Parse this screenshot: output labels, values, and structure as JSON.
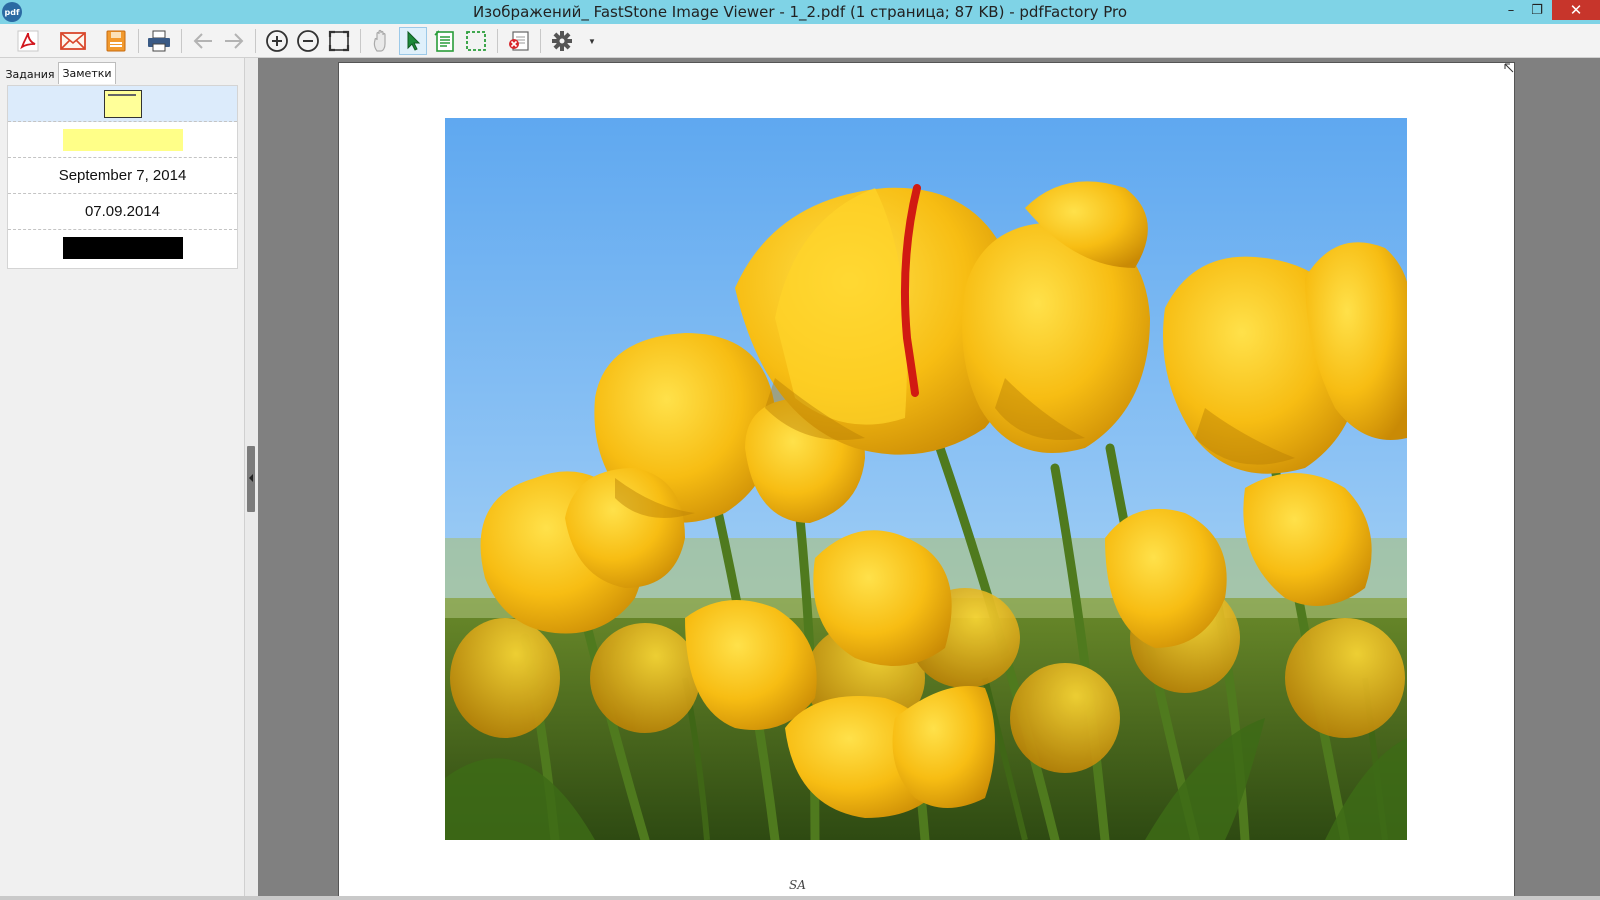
{
  "window": {
    "app_icon": "pdf",
    "title": "Изображений_ FastStone Image Viewer - 1_2.pdf (1 страница; 87 KB) - pdfFactory Pro",
    "controls": {
      "minimize": "–",
      "maximize": "❐",
      "close": "✕"
    }
  },
  "toolbar": {
    "buttons": [
      {
        "icon": "pdf-acrobat-icon"
      },
      {
        "icon": "email-icon"
      },
      {
        "icon": "save-icon"
      },
      {
        "icon": "print-icon"
      },
      {
        "icon": "back-arrow-icon"
      },
      {
        "icon": "forward-arrow-icon"
      },
      {
        "icon": "zoom-in-icon"
      },
      {
        "icon": "zoom-out-icon"
      },
      {
        "icon": "fit-page-icon"
      },
      {
        "icon": "hand-pan-icon"
      },
      {
        "icon": "select-pointer-icon",
        "active": true
      },
      {
        "icon": "text-select-icon"
      },
      {
        "icon": "snapshot-select-icon"
      },
      {
        "icon": "delete-page-icon"
      },
      {
        "icon": "settings-gear-icon"
      }
    ],
    "gear_caret": "▼"
  },
  "left_panel": {
    "tabs": [
      {
        "label": "Задания"
      },
      {
        "label": "Заметки",
        "selected": true
      }
    ],
    "notes": [
      {
        "type": "sticky-note-thumbnail"
      },
      {
        "type": "highlight-swatch",
        "color": "#ffff88"
      },
      {
        "type": "text",
        "text": "September 7, 2014"
      },
      {
        "type": "text",
        "text": "07.09.2014"
      },
      {
        "type": "redaction-swatch",
        "color": "#000000"
      }
    ]
  },
  "document": {
    "page_count": 1,
    "footer_signature": "SA",
    "colors": {
      "background": "#808080",
      "page": "#ffffff"
    }
  }
}
